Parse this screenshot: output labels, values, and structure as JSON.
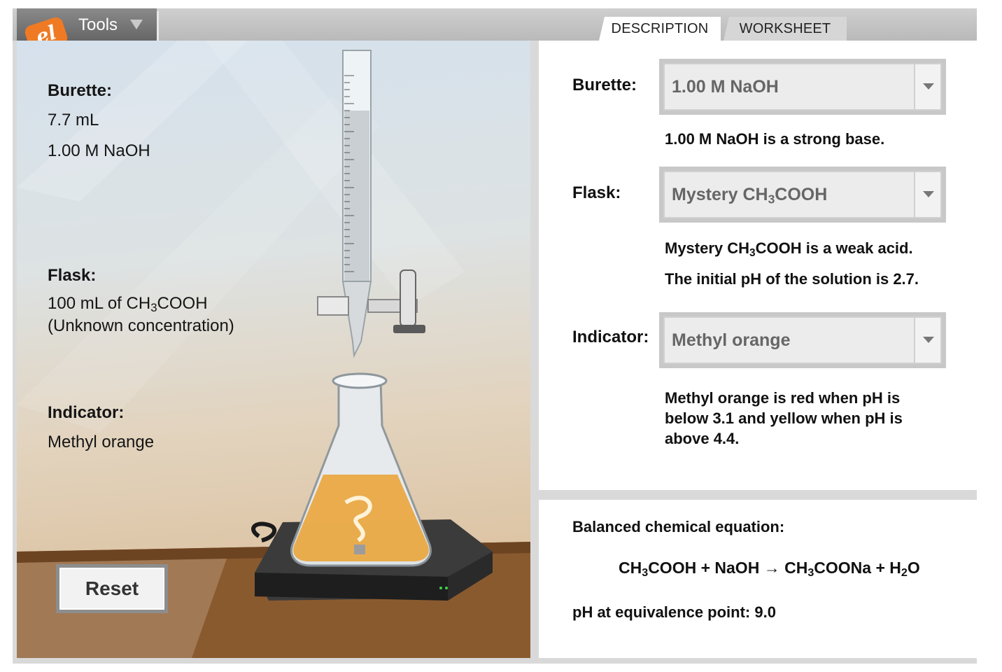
{
  "toolbar": {
    "tools_label": "Tools"
  },
  "tabs": [
    {
      "label": "DESCRIPTION",
      "selected": true
    },
    {
      "label": "WORKSHEET",
      "selected": false
    }
  ],
  "scene": {
    "burette_heading": "Burette:",
    "burette_volume": "7.7 mL",
    "burette_solution": "1.00 M NaOH",
    "flask_heading": "Flask:",
    "flask_line1_pre": "100 mL of CH",
    "flask_line1_sub": "3",
    "flask_line1_post": "COOH",
    "flask_line2": "(Unknown concentration)",
    "indicator_heading": "Indicator:",
    "indicator_name": "Methyl orange",
    "reset_label": "Reset"
  },
  "description": {
    "burette": {
      "label": "Burette:",
      "selected": "1.00 M NaOH",
      "note": "1.00 M NaOH is a strong base."
    },
    "flask": {
      "label": "Flask:",
      "selected_pre": "Mystery CH",
      "selected_sub": "3",
      "selected_post": "COOH",
      "note_pre": "Mystery CH",
      "note_sub": "3",
      "note_post": "COOH is a weak acid.",
      "note2": "The initial pH of the solution is 2.7."
    },
    "indicator": {
      "label": "Indicator:",
      "selected": "Methyl orange",
      "note_line1": "Methyl orange is red when pH is",
      "note_line2": "below 3.1 and yellow when pH is",
      "note_line3": "above 4.4."
    }
  },
  "equation": {
    "heading": "Balanced chemical equation:",
    "parts": {
      "a1": "CH",
      "a1s": "3",
      "a2": "COOH + NaOH → CH",
      "a2s": "3",
      "a3": "COONa + H",
      "a3s": "2",
      "a4": "O"
    },
    "equivalence": "pH at equivalence point: 9.0"
  },
  "colors": {
    "tools_orange": "#f07a23",
    "solution_orange": "#eaa53c",
    "panel_gray": "#d9d9d9"
  }
}
